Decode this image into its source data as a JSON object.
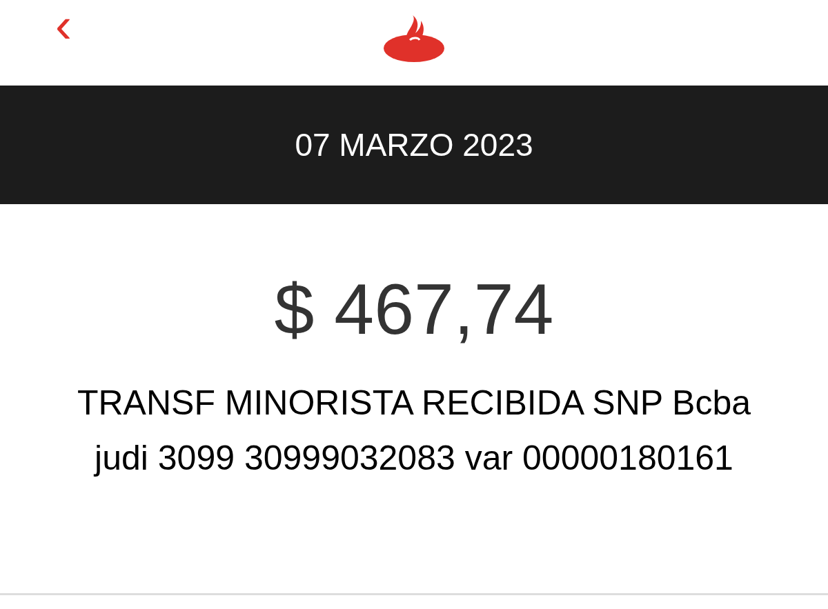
{
  "header": {
    "back": "‹"
  },
  "date_banner": {
    "date": "07 MARZO 2023"
  },
  "transaction": {
    "amount": "$ 467,74",
    "description": "TRANSF MINORISTA RECIBIDA SNP Bcba judi 3099 30999032083 var 00000180161"
  }
}
